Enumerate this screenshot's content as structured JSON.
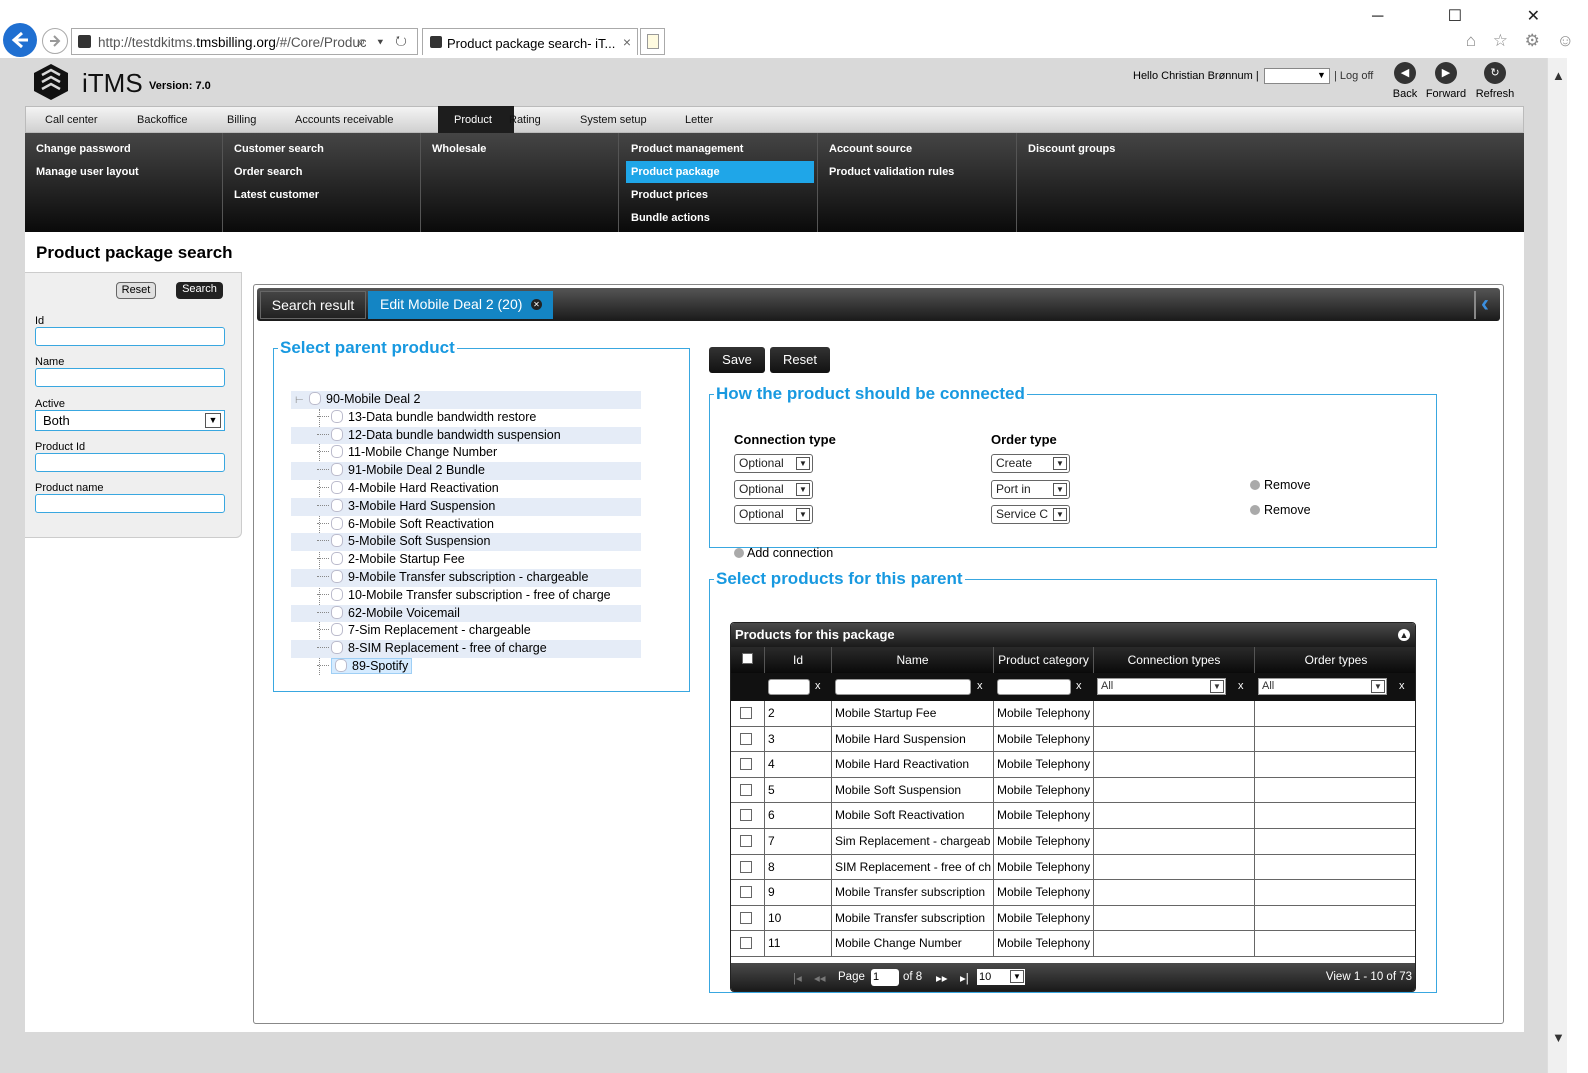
{
  "browser": {
    "url_prefix": "http://testdkitms.",
    "url_domain": "tmsbilling.org",
    "url_suffix": "/#/Core/Produc",
    "tab_title": "Product package search- iT...",
    "address_icons": "⌕ ▾ ↻",
    "tab_close": "×",
    "window_controls": "─ ☐ ✕",
    "right_icons": "⌂ ☆ ⚙ ☺"
  },
  "header": {
    "app_name": "iTMS",
    "version": "Version: 7.0",
    "greeting": "Hello Christian Brønnum |",
    "logoff": "| Log off",
    "back_label": "Back",
    "forward_label": "Forward",
    "refresh_label": "Refresh"
  },
  "main_menu": [
    "Call center",
    "Backoffice",
    "Billing",
    "Accounts receivable",
    "Product",
    "Rating",
    "System setup",
    "Letter"
  ],
  "main_menu_active": "Product",
  "sub_menu": {
    "col1": [
      "Change password",
      "Manage user layout"
    ],
    "col2": [
      "Customer search",
      "Order search",
      "Latest customer"
    ],
    "col3": [
      "Wholesale"
    ],
    "col4": [
      "Product management",
      "Product package",
      "Product prices",
      "Bundle actions"
    ],
    "col5": [
      "Account source",
      "Product validation rules"
    ],
    "col6": [
      "Discount groups"
    ]
  },
  "sub_menu_active": "Product package",
  "page_title": "Product package search",
  "search_panel": {
    "reset_label": "Reset",
    "search_label": "Search",
    "fields": {
      "id": "Id",
      "name": "Name",
      "active": "Active",
      "active_value": "Both",
      "product_id": "Product Id",
      "product_name": "Product name"
    }
  },
  "tabs": {
    "search_result": "Search result",
    "edit": "Edit Mobile Deal 2 (20)"
  },
  "parent_section": {
    "legend": "Select parent product",
    "root": "90-Mobile Deal 2",
    "items": [
      "13-Data bundle bandwidth restore",
      "12-Data bundle bandwidth suspension",
      "11-Mobile Change Number",
      "91-Mobile Deal 2 Bundle",
      "4-Mobile Hard Reactivation",
      "3-Mobile Hard Suspension",
      "6-Mobile Soft Reactivation",
      "5-Mobile Soft Suspension",
      "2-Mobile Startup Fee",
      "9-Mobile Transfer subscription - chargeable",
      "10-Mobile Transfer subscription - free of charge",
      "62-Mobile Voicemail",
      "7-Sim Replacement - chargeable",
      "8-SIM Replacement - free of charge"
    ],
    "selected": "89-Spotify"
  },
  "actions": {
    "save": "Save",
    "reset": "Reset"
  },
  "connect_section": {
    "legend": "How the product should be connected",
    "connection_type_header": "Connection type",
    "order_type_header": "Order type",
    "rows": [
      {
        "connection": "Optional",
        "order": "Create",
        "remove": ""
      },
      {
        "connection": "Optional",
        "order": "Port in",
        "remove": "Remove"
      },
      {
        "connection": "Optional",
        "order": "Service C",
        "remove": "Remove"
      }
    ],
    "add_connection": "Add connection"
  },
  "products_section": {
    "legend": "Select products for this parent",
    "grid_caption": "Products for this package",
    "columns": [
      "Id",
      "Name",
      "Product category",
      "Connection types",
      "Order types"
    ],
    "filter_all_1": "All",
    "filter_all_2": "All",
    "filter_clear": "x",
    "rows": [
      {
        "id": "2",
        "name": "Mobile Startup Fee",
        "category": "Mobile Telephony"
      },
      {
        "id": "3",
        "name": "Mobile Hard Suspension",
        "category": "Mobile Telephony"
      },
      {
        "id": "4",
        "name": "Mobile Hard Reactivation",
        "category": "Mobile Telephony"
      },
      {
        "id": "5",
        "name": "Mobile Soft Suspension",
        "category": "Mobile Telephony"
      },
      {
        "id": "6",
        "name": "Mobile Soft Reactivation",
        "category": "Mobile Telephony"
      },
      {
        "id": "7",
        "name": "Sim Replacement - chargeab",
        "category": "Mobile Telephony"
      },
      {
        "id": "8",
        "name": "SIM Replacement - free of ch",
        "category": "Mobile Telephony"
      },
      {
        "id": "9",
        "name": "Mobile Transfer subscription",
        "category": "Mobile Telephony"
      },
      {
        "id": "10",
        "name": "Mobile Transfer subscription",
        "category": "Mobile Telephony"
      },
      {
        "id": "11",
        "name": "Mobile Change Number",
        "category": "Mobile Telephony"
      }
    ],
    "pager": {
      "page_label": "Page",
      "page_value": "1",
      "of_label": "of 8",
      "page_size": "10",
      "view_text": "View 1 - 10 of 73"
    }
  },
  "colors": {
    "accent": "#1899e0",
    "active_tab": "#1485c4",
    "submenu_highlight": "#1fa6e8"
  }
}
